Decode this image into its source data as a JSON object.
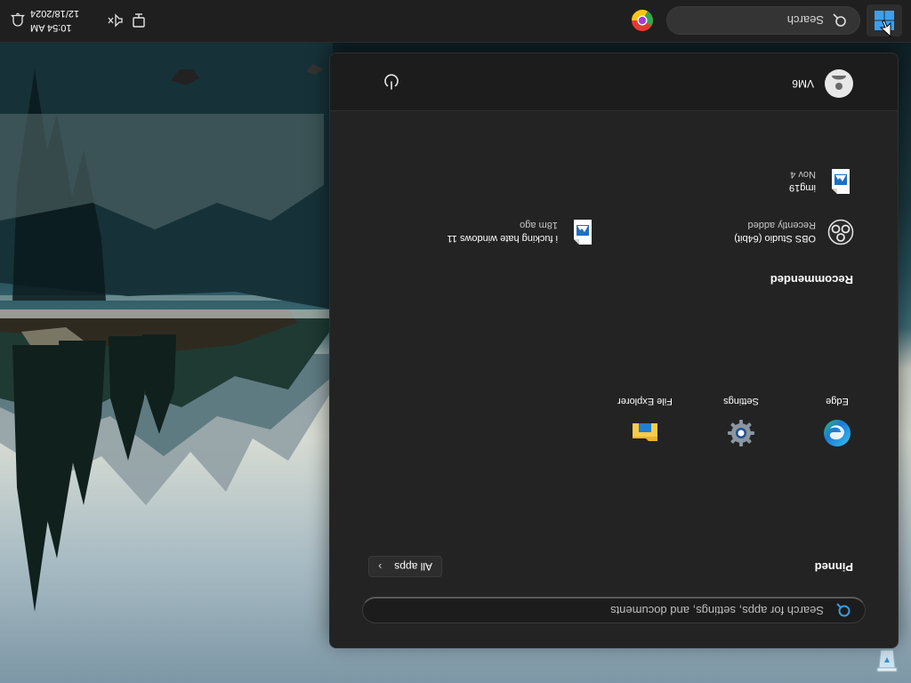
{
  "start_menu": {
    "search_placeholder": "Search for apps, settings, and documents",
    "pinned_title": "Pinned",
    "all_apps_label": "All apps",
    "pinned_apps": [
      {
        "label": "Edge",
        "icon": "edge-icon"
      },
      {
        "label": "Settings",
        "icon": "gear-icon"
      },
      {
        "label": "File Explorer",
        "icon": "folder-icon"
      }
    ],
    "recommended_title": "Recommended",
    "recommended": [
      {
        "name": "OBS Studio (64bit)",
        "sub": "Recently added",
        "icon": "obs-icon"
      },
      {
        "name": "i fucking hate windows 11",
        "sub": "18m ago",
        "icon": "image-file-icon"
      },
      {
        "name": "img19",
        "sub": "Nov 4",
        "icon": "image-file-icon"
      }
    ],
    "user_name": "VM6",
    "power_icon": "power-icon"
  },
  "taskbar": {
    "search_label": "Search",
    "start_icon": "windows-logo-icon",
    "pinned_app_icon": "chrome-icon",
    "clock_time": "10:54 AM",
    "clock_date": "12/18/2024",
    "tray_icons": [
      "network-icon",
      "volume-icon",
      "notification-icon"
    ]
  },
  "desktop": {
    "icons": [
      "recycle-bin-icon"
    ]
  },
  "colors": {
    "menu_bg": "#232323",
    "taskbar_bg": "#1f1f1f",
    "accent": "#0078d4"
  }
}
